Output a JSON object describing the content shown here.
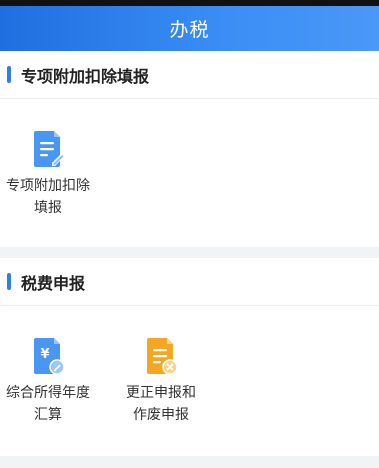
{
  "header": {
    "title": "办税"
  },
  "sections": [
    {
      "title": "专项附加扣除填报",
      "items": [
        {
          "label": "专项附加扣除\n填报",
          "icon": "document-edit-icon",
          "color": "#3f8ff3"
        }
      ]
    },
    {
      "title": "税费申报",
      "items": [
        {
          "label": "综合所得年度\n汇算",
          "icon": "yuan-document-icon",
          "color": "#3f8ff3"
        },
        {
          "label": "更正申报和\n作废申报",
          "icon": "document-cancel-icon",
          "color": "#f5a623"
        }
      ]
    }
  ],
  "colors": {
    "accent": "#2d7ef2",
    "header_start": "#1f6fe0",
    "header_end": "#4a98f7",
    "orange": "#f5a623"
  }
}
